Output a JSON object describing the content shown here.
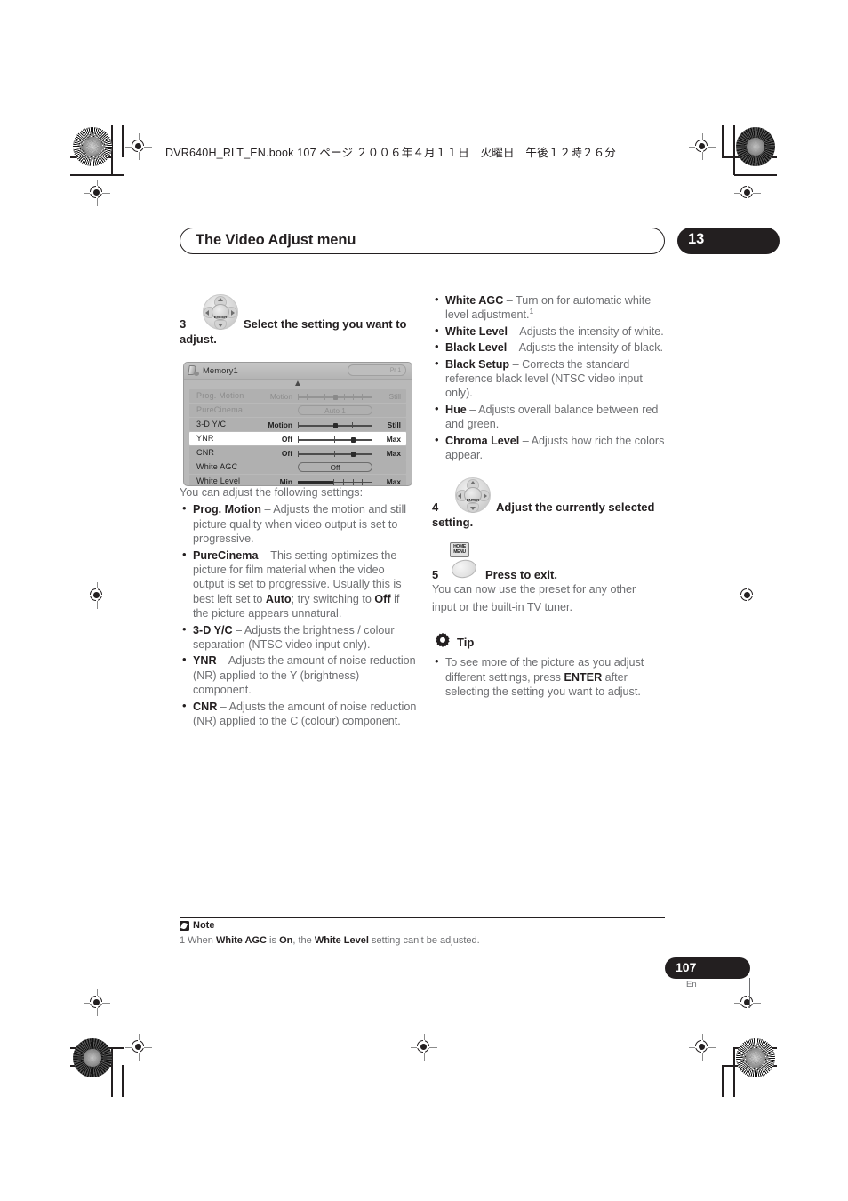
{
  "print_header": {
    "file_line": "DVR640H_RLT_EN.book  107 ページ  ２００６年４月１１日　火曜日　午後１２時２６分"
  },
  "header": {
    "title": "The Video Adjust menu",
    "chapter_number": "13"
  },
  "steps": {
    "step3": {
      "number": "3",
      "icon": "dpad-enter-icon",
      "text_line1": "Select the setting you want to",
      "text_line2": "adjust."
    },
    "step4": {
      "number": "4",
      "icon": "dpad-enter-icon",
      "text_line1": "Adjust the currently selected",
      "text_line2": "setting."
    },
    "step5": {
      "number": "5",
      "icon": "home-menu-button-icon",
      "icon_label": "HOME MENU",
      "text": "Press to exit.",
      "followup_line1": "You can now use the preset for any other",
      "followup_line2": "input or the built-in TV tuner."
    }
  },
  "osd": {
    "title": "Memory1",
    "preset_badge": "Pr 1",
    "scroll_up": "▲",
    "scroll_down": "▼",
    "rows": [
      {
        "name": "Prog.  Motion",
        "type": "slider",
        "low": "Motion",
        "high": "Still",
        "position": 50,
        "ticks": 9,
        "state": "dim"
      },
      {
        "name": "PureCinema",
        "type": "option",
        "value": "Auto 1",
        "state": "dim"
      },
      {
        "name": "3-D  Y/C",
        "type": "slider",
        "low": "Motion",
        "high": "Still",
        "position": 50,
        "ticks": 5,
        "state": "normal"
      },
      {
        "name": "YNR",
        "type": "slider",
        "low": "Off",
        "high": "Max",
        "position": 75,
        "ticks": 5,
        "state": "selected"
      },
      {
        "name": "CNR",
        "type": "slider",
        "low": "Off",
        "high": "Max",
        "position": 75,
        "ticks": 5,
        "state": "normal"
      },
      {
        "name": "White  AGC",
        "type": "option",
        "value": "Off",
        "state": "normal"
      },
      {
        "name": "White  Level",
        "type": "slider-fill",
        "low": "Min",
        "high": "Max",
        "position": 45,
        "ticks": 5,
        "state": "normal"
      }
    ]
  },
  "left_column": {
    "intro": "You can adjust the following settings:",
    "settings": [
      {
        "term": "Prog. Motion",
        "desc": " – Adjusts the motion and still picture quality when video output is set to progressive."
      },
      {
        "term": "PureCinema",
        "desc": " –  This setting optimizes the picture for film material when the video output is set to progressive. Usually this is best left set to ",
        "bold_mid": "Auto",
        "desc2": "; try switching to ",
        "bold_mid2": "Off",
        "desc3": " if the picture appears unnatural."
      },
      {
        "term": "3-D Y/C",
        "desc": " – Adjusts the brightness / colour separation (NTSC video input only)."
      },
      {
        "term": "YNR",
        "desc": " – Adjusts the amount of noise reduction (NR) applied to the Y (brightness) component."
      },
      {
        "term": "CNR",
        "desc": " – Adjusts the amount of noise reduction (NR) applied to the C (colour) component."
      }
    ]
  },
  "right_column": {
    "settings": [
      {
        "term": "White AGC",
        "desc": " – Turn on for automatic white level adjustment.",
        "footnote": "1"
      },
      {
        "term": "White Level",
        "desc": " – Adjusts the intensity of white."
      },
      {
        "term": "Black Level",
        "desc": " – Adjusts the intensity of black."
      },
      {
        "term": "Black Setup",
        "desc": " – Corrects the standard reference black level (NTSC video input only)."
      },
      {
        "term": "Hue",
        "desc": " – Adjusts overall balance between red and green."
      },
      {
        "term": "Chroma Level",
        "desc": " – Adjusts how rich the colors appear."
      }
    ]
  },
  "tip": {
    "icon": "gear-icon",
    "label": "Tip",
    "body_pre": "To see more of the picture as you adjust different settings, press ",
    "body_bold": "ENTER",
    "body_post": " after selecting the setting you want to adjust."
  },
  "note": {
    "icon": "note-pencil-icon",
    "label": "Note",
    "marker": "1",
    "pre": "1 When ",
    "b1": "White AGC",
    "mid1": " is ",
    "b2": "On",
    "mid2": ", the ",
    "b3": "White Level",
    "post": " setting can’t be adjusted."
  },
  "footer": {
    "page_number": "107",
    "language": "En"
  }
}
